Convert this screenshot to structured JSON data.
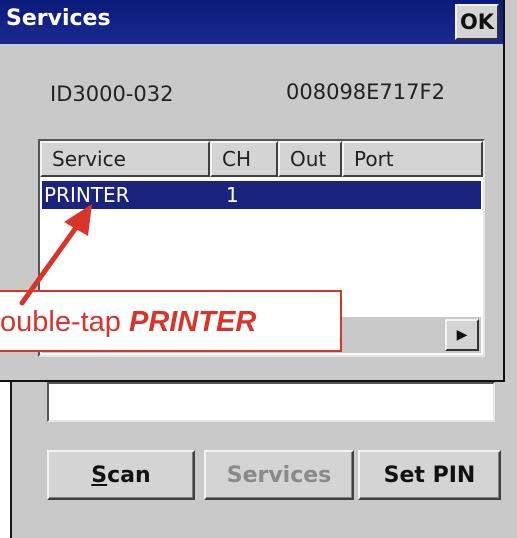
{
  "window": {
    "title": "Services",
    "ok_label": "OK"
  },
  "device": {
    "name": "ID3000-032",
    "address": "008098E717F2"
  },
  "services_list": {
    "columns": [
      "Service",
      "CH",
      "Out",
      "Port"
    ],
    "rows": [
      {
        "service": "PRINTER",
        "ch": "1",
        "out": "",
        "port": "",
        "selected": true
      }
    ]
  },
  "buttons": {
    "scan": "Scan",
    "scan_underline": "S",
    "scan_rest": "can",
    "services": "Services",
    "set_pin": "Set PIN"
  },
  "annotation": {
    "prefix": "ouble-tap ",
    "emphasis": "PRINTER",
    "color": "#d9342b"
  },
  "colors": {
    "titlebar": "#1a237e",
    "selection": "#1a237e",
    "dialog_bg": "#c9c9c9"
  },
  "icons": {
    "scroll_right": "right-triangle-icon"
  }
}
